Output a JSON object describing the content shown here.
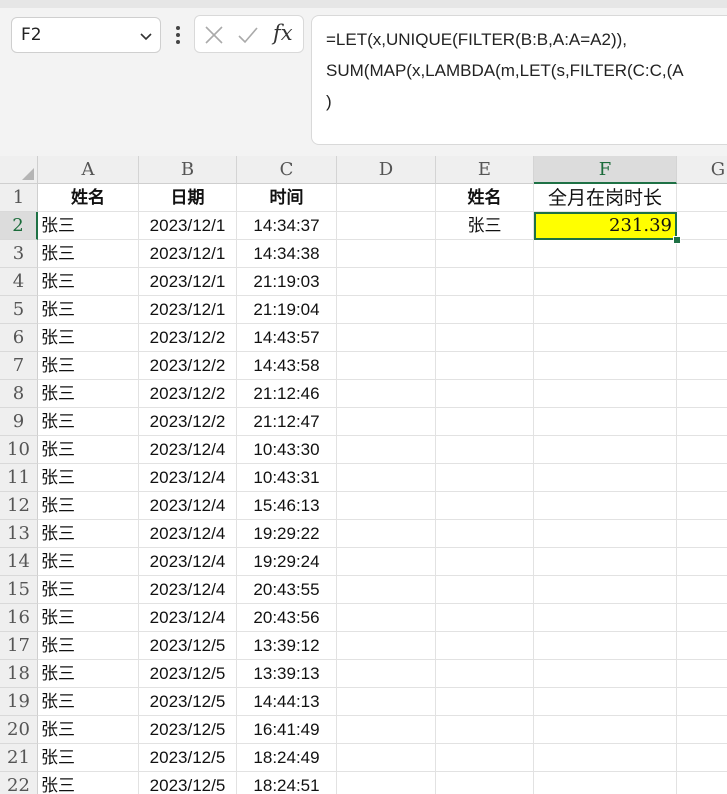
{
  "name_box": {
    "value": "F2"
  },
  "formula_bar": {
    "formula": "=LET(x,UNIQUE(FILTER(B:B,A:A=A2)),\nSUM(MAP(x,LAMBDA(m,LET(s,FILTER(C:C,(A\n)"
  },
  "columns": [
    "A",
    "B",
    "C",
    "D",
    "E",
    "F",
    "G"
  ],
  "rows": [
    "1",
    "2",
    "3",
    "4",
    "5",
    "6",
    "7",
    "8",
    "9",
    "10",
    "11",
    "12",
    "13",
    "14",
    "15",
    "16",
    "17",
    "18",
    "19",
    "20",
    "21",
    "22"
  ],
  "table": {
    "headers": {
      "name": "姓名",
      "date": "日期",
      "time": "时间"
    },
    "records": [
      {
        "name": "张三",
        "date": "2023/12/1",
        "time": "14:34:37"
      },
      {
        "name": "张三",
        "date": "2023/12/1",
        "time": "14:34:38"
      },
      {
        "name": "张三",
        "date": "2023/12/1",
        "time": "21:19:03"
      },
      {
        "name": "张三",
        "date": "2023/12/1",
        "time": "21:19:04"
      },
      {
        "name": "张三",
        "date": "2023/12/2",
        "time": "14:43:57"
      },
      {
        "name": "张三",
        "date": "2023/12/2",
        "time": "14:43:58"
      },
      {
        "name": "张三",
        "date": "2023/12/2",
        "time": "21:12:46"
      },
      {
        "name": "张三",
        "date": "2023/12/2",
        "time": "21:12:47"
      },
      {
        "name": "张三",
        "date": "2023/12/4",
        "time": "10:43:30"
      },
      {
        "name": "张三",
        "date": "2023/12/4",
        "time": "10:43:31"
      },
      {
        "name": "张三",
        "date": "2023/12/4",
        "time": "15:46:13"
      },
      {
        "name": "张三",
        "date": "2023/12/4",
        "time": "19:29:22"
      },
      {
        "name": "张三",
        "date": "2023/12/4",
        "time": "19:29:24"
      },
      {
        "name": "张三",
        "date": "2023/12/4",
        "time": "20:43:55"
      },
      {
        "name": "张三",
        "date": "2023/12/4",
        "time": "20:43:56"
      },
      {
        "name": "张三",
        "date": "2023/12/5",
        "time": "13:39:12"
      },
      {
        "name": "张三",
        "date": "2023/12/5",
        "time": "13:39:13"
      },
      {
        "name": "张三",
        "date": "2023/12/5",
        "time": "14:44:13"
      },
      {
        "name": "张三",
        "date": "2023/12/5",
        "time": "16:41:49"
      },
      {
        "name": "张三",
        "date": "2023/12/5",
        "time": "18:24:49"
      },
      {
        "name": "张三",
        "date": "2023/12/5",
        "time": "18:24:51"
      }
    ]
  },
  "summary": {
    "header_name": "姓名",
    "header_total": "全月在岗时长",
    "name": "张三",
    "total": "231.39"
  },
  "colors": {
    "highlight": "#ffff00",
    "accent": "#1e7145"
  },
  "selection": {
    "column": "F",
    "row": "2"
  }
}
